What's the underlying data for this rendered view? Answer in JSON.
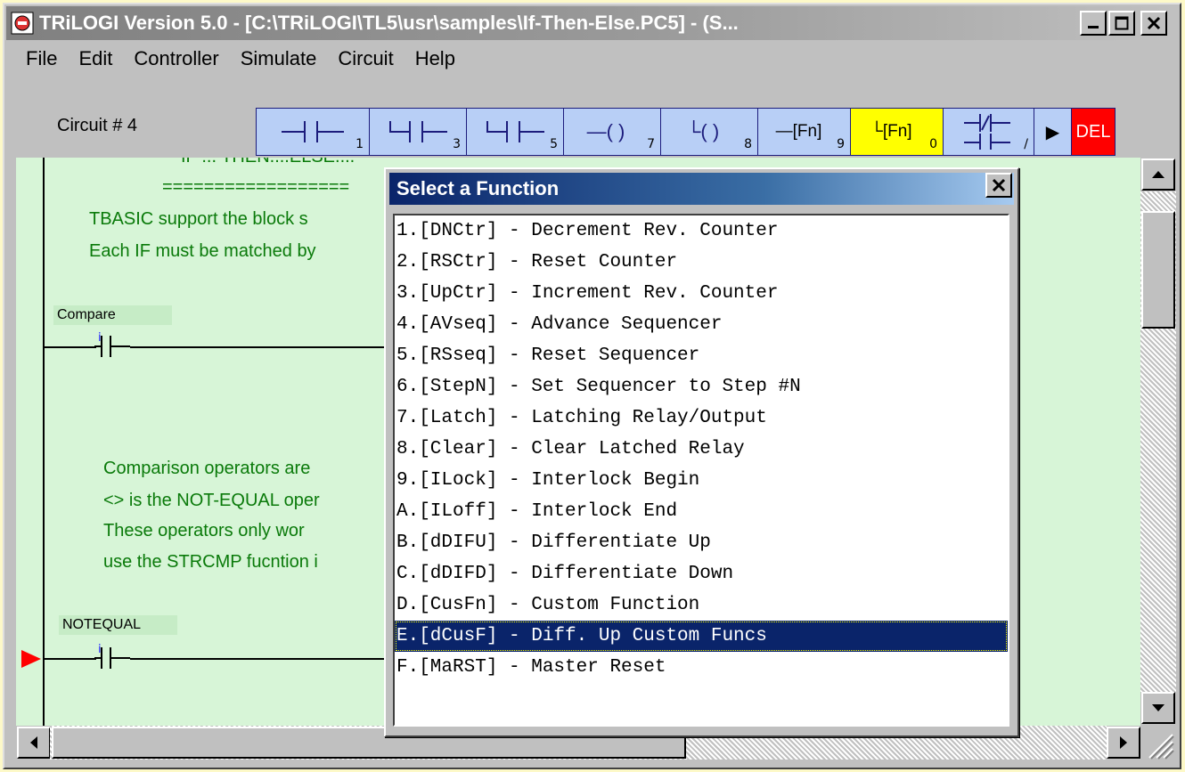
{
  "window": {
    "title": "TRiLOGI Version 5.0 - [C:\\TRiLOGI\\TL5\\usr\\samples\\If-Then-Else.PC5] - (S..."
  },
  "menu": [
    "File",
    "Edit",
    "Controller",
    "Simulate",
    "Circuit",
    "Help"
  ],
  "toolbar": {
    "circuit_label": "Circuit # 4",
    "tools": [
      {
        "icon": "contact-open-icon",
        "sub": "1"
      },
      {
        "icon": "contact-parallel-icon",
        "sub": "3"
      },
      {
        "icon": "contact-branch-icon",
        "sub": "5"
      },
      {
        "icon": "coil-icon",
        "label": "—( )",
        "sub": "7"
      },
      {
        "icon": "coil-branch-icon",
        "label": "└( )",
        "sub": "8"
      },
      {
        "icon": "function-icon",
        "label": "—[Fn]",
        "sub": "9"
      },
      {
        "icon": "function-branch-icon",
        "label": "└[Fn]",
        "sub": "0"
      },
      {
        "icon": "invert-contact-icon",
        "sub": "/"
      },
      {
        "icon": "play-icon",
        "label": "▶"
      },
      {
        "icon": "delete-icon",
        "label": "DEL"
      }
    ]
  },
  "ladder": {
    "header_partial": "IF ... THEN....ELSE....",
    "separator": "==================",
    "notes_1": [
      "TBASIC support the block s",
      "Each IF must be matched by"
    ],
    "contact_1": "Compare",
    "notes_2": [
      "Comparison operators are",
      "<> is the NOT-EQUAL oper",
      "These operators only wor",
      "use the STRCMP fucntion i"
    ],
    "contact_2": "NOTEQUAL"
  },
  "dialog": {
    "title": "Select a Function",
    "items": [
      "1.[DNCtr] - Decrement Rev. Counter",
      "2.[RSCtr] - Reset Counter",
      "3.[UpCtr] - Increment Rev. Counter",
      "4.[AVseq] - Advance Sequencer",
      "5.[RSseq] - Reset Sequencer",
      "6.[StepN] - Set Sequencer to Step #N",
      "7.[Latch] - Latching Relay/Output",
      "8.[Clear] - Clear Latched Relay",
      "9.[ILock] - Interlock Begin",
      "A.[ILoff] - Interlock End",
      "B.[dDIFU] - Differentiate Up",
      "C.[dDIFD] - Differentiate Down",
      "D.[CusFn] - Custom Function",
      "E.[dCusF] - Diff. Up Custom Funcs",
      "F.[MaRST] - Master Reset"
    ],
    "selected_index": 13
  },
  "colors": {
    "canvas_bg": "#d7f5d7",
    "note_text": "#0a7a0a",
    "selection": "#0a246a",
    "tool_bg": "#b8cff6",
    "tool_active": "#ffff00",
    "delete_bg": "#ff0000"
  }
}
